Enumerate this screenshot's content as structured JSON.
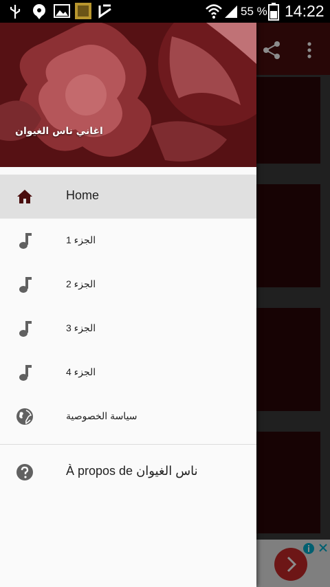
{
  "status_bar": {
    "battery_percent": "55 %",
    "time": "14:22"
  },
  "app": {
    "share_icon": "share-icon",
    "more_icon": "more-vert-icon"
  },
  "drawer": {
    "header_title": "اغاني ناس الغيوان",
    "items": [
      {
        "label": "Home",
        "icon": "home-icon",
        "active": true
      },
      {
        "label": "الجزء 1",
        "icon": "music-note-icon"
      },
      {
        "label": "الجزء 2",
        "icon": "music-note-icon"
      },
      {
        "label": "الجزء 3",
        "icon": "music-note-icon"
      },
      {
        "label": "الجزء 4",
        "icon": "music-note-icon"
      },
      {
        "label": "سياسة الخصوصية",
        "icon": "globe-icon"
      }
    ],
    "about": {
      "label": "À propos de ناس الغيوان",
      "icon": "help-icon"
    }
  },
  "colors": {
    "header": "#5a1216",
    "active_item": "#e0e0e0",
    "home_icon": "#4a0d0d",
    "icon_gray": "#616161"
  }
}
